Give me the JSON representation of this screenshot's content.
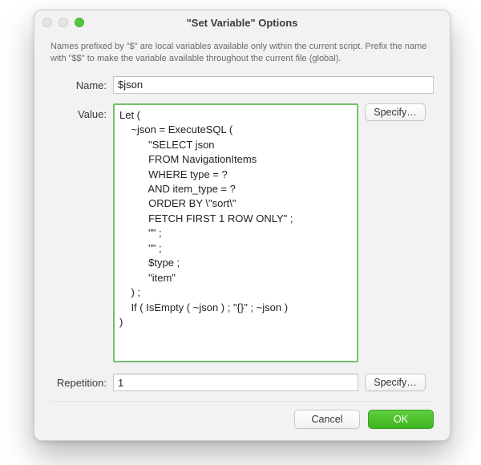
{
  "window": {
    "title": "\"Set Variable\" Options"
  },
  "description": "Names prefixed by \"$\" are local variables available only within the current script. Prefix the name with \"$$\" to make the variable available throughout the current file (global).",
  "labels": {
    "name": "Name:",
    "value": "Value:",
    "repetition": "Repetition:"
  },
  "fields": {
    "name_value": "$json",
    "value_text": "Let (\n    ~json = ExecuteSQL (\n          \"SELECT json\n          FROM NavigationItems\n          WHERE type = ?\n          AND item_type = ?\n          ORDER BY \\\"sort\\\"\n          FETCH FIRST 1 ROW ONLY\" ;\n          \"\" ;\n          \"\" ;\n          $type ;\n          \"item\"\n    ) ;\n    If ( IsEmpty ( ~json ) ; \"{}\" ; ~json )\n)",
    "repetition_value": "1"
  },
  "buttons": {
    "specify": "Specify…",
    "cancel": "Cancel",
    "ok": "OK"
  }
}
